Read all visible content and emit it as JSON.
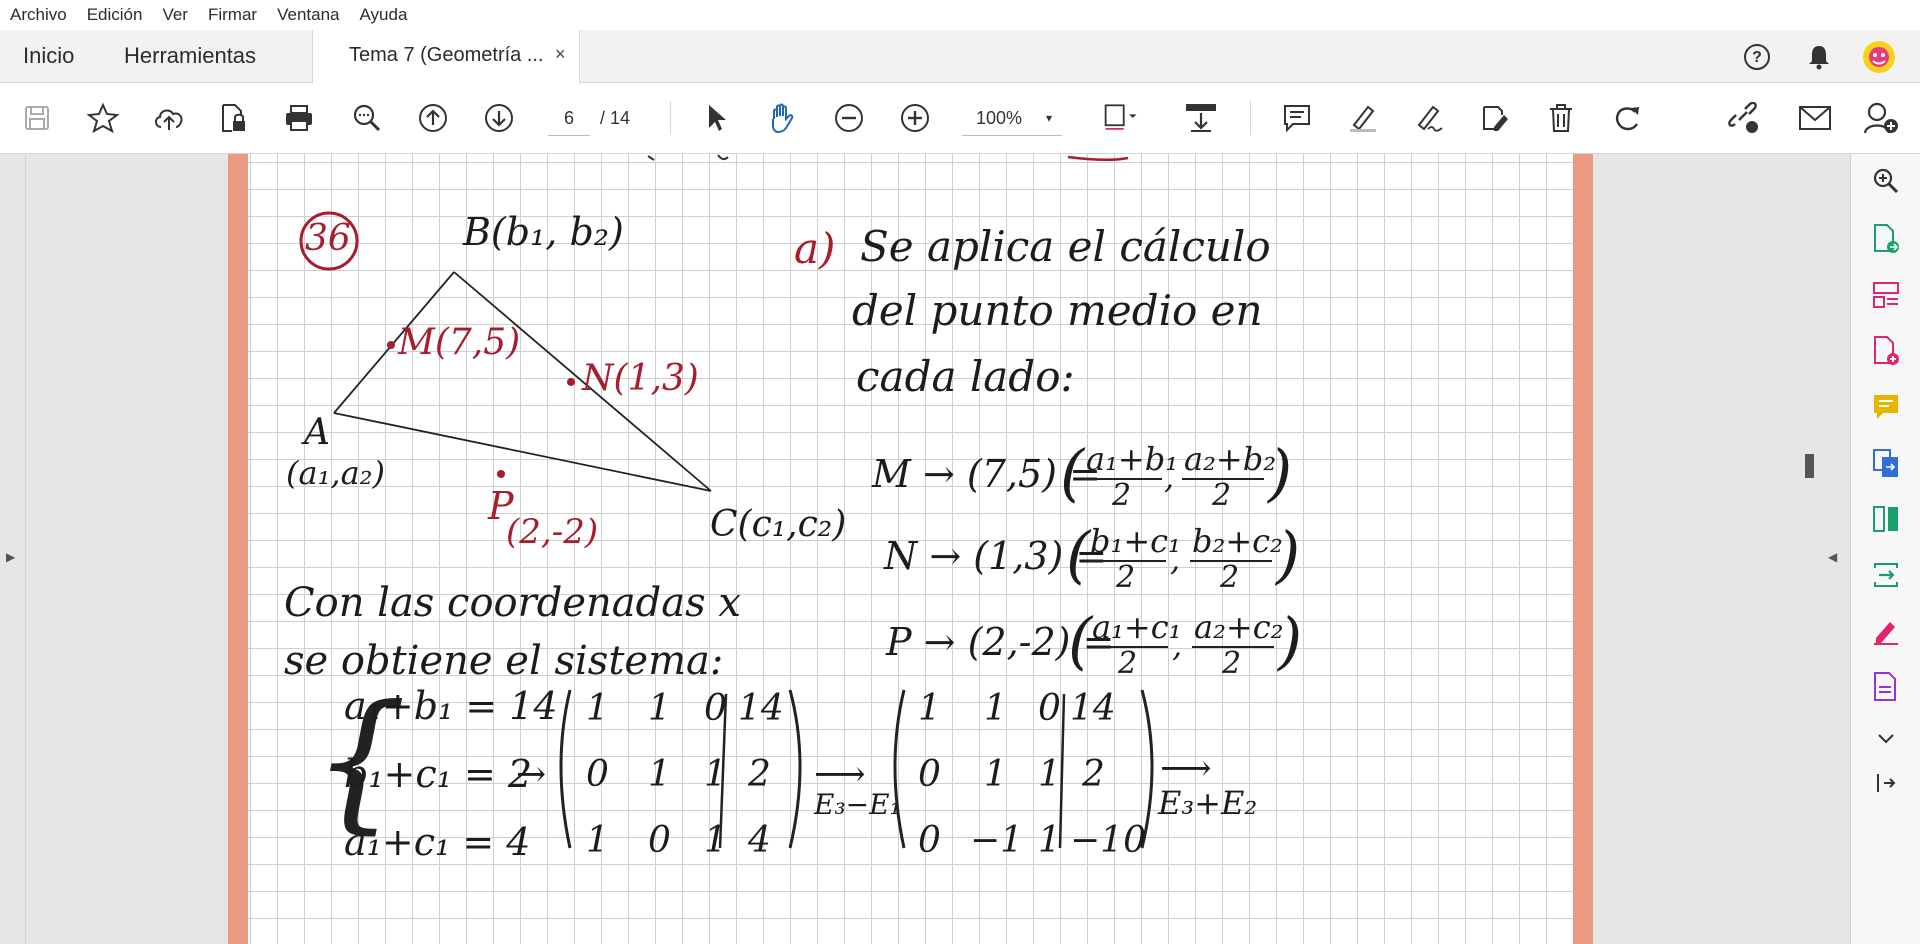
{
  "menu": [
    "Archivo",
    "Edición",
    "Ver",
    "Firmar",
    "Ventana",
    "Ayuda"
  ],
  "tabs": {
    "home": "Inicio",
    "tools": "Herramientas",
    "document": "Tema 7 (Geometría ...",
    "close": "×"
  },
  "toolbar": {
    "page_current": "6",
    "page_total": "/ 14",
    "zoom": "100%",
    "zoom_arrow": "▾"
  },
  "document": {
    "problem_number": "36",
    "vertex_b": "B(b₁, b₂)",
    "vertex_a": "A",
    "vertex_a_coords": "(a₁,a₂)",
    "vertex_c": "C(c₁,c₂)",
    "point_m": "M(7,5)",
    "point_n": "N(1,3)",
    "point_p": "P",
    "point_p_coords": "(2,-2)",
    "part_a_label": "a)",
    "part_a_line1": "Se aplica el cálculo",
    "part_a_line2": "del punto medio en",
    "part_a_line3": "cada lado:",
    "eq_m_left": "M → (7,5) =",
    "eq_m_frac1_num": "a₁+b₁",
    "eq_m_frac1_den": "2",
    "eq_m_frac2_num": "a₂+b₂",
    "eq_m_frac2_den": "2",
    "eq_n_left": "N → (1,3) =",
    "eq_n_frac1_num": "b₁+c₁",
    "eq_n_frac1_den": "2",
    "eq_n_frac2_num": "b₂+c₂",
    "eq_n_frac2_den": "2",
    "eq_p_left": "P → (2,-2) =",
    "eq_p_frac1_num": "a₁+c₁",
    "eq_p_frac1_den": "2",
    "eq_p_frac2_num": "a₂+c₂",
    "eq_p_frac2_den": "2",
    "text_line1": "Con las coordenadas x",
    "text_line2": "se obtiene el sistema:",
    "sys_eq1": "a₁+b₁ = 14",
    "sys_eq2": "b₁+c₁ = 2",
    "sys_eq3": "a₁+c₁ = 4",
    "matrix1_rows": [
      [
        "1",
        "1",
        "0",
        "14"
      ],
      [
        "0",
        "1",
        "1",
        "2"
      ],
      [
        "1",
        "0",
        "1",
        "4"
      ]
    ],
    "op1": "E₃−E₁",
    "matrix2_rows": [
      [
        "1",
        "1",
        "0",
        "14"
      ],
      [
        "0",
        "1",
        "1",
        "2"
      ],
      [
        "0",
        "−1",
        "1",
        "−10"
      ]
    ],
    "op2": "E₃+E₂"
  },
  "icons": [
    "save-icon",
    "star-icon",
    "upload-icon",
    "file-lock-icon",
    "print-icon",
    "zoom-icon",
    "arrow-up-icon",
    "arrow-down-icon",
    "pointer-icon",
    "hand-icon",
    "zoom-out-icon",
    "zoom-in-icon",
    "fit-icon",
    "scroll-icon",
    "comment-icon",
    "highlight-icon",
    "sign-icon",
    "edit-icon",
    "trash-icon",
    "redo-icon",
    "link-icon",
    "mail-icon",
    "add-user-icon"
  ],
  "colors": {
    "accent_red": "#a61d2e",
    "page_border": "#ea9a82",
    "tool_green": "#1a9e6a",
    "tool_pink": "#e0246f",
    "tool_yellow": "#e8b400",
    "tool_blue": "#2f6fd6",
    "tool_purple": "#9b2fd6"
  }
}
